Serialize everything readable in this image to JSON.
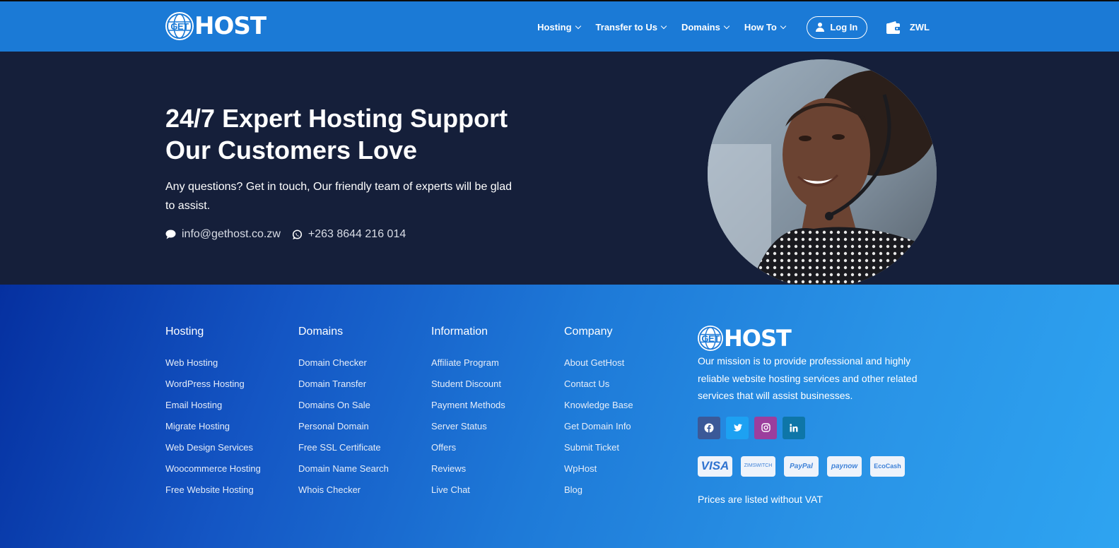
{
  "header": {
    "logo": {
      "prefix": "GET",
      "name": "HOST"
    },
    "nav": [
      {
        "label": "Hosting"
      },
      {
        "label": "Transfer to Us"
      },
      {
        "label": "Domains"
      },
      {
        "label": "How To"
      }
    ],
    "login_label": "Log In",
    "currency": "ZWL",
    "colors": {
      "header_bg": "#1b7ad6"
    }
  },
  "hero": {
    "title_line1": "24/7 Expert Hosting Support",
    "title_line2": "Our Customers Love",
    "subtitle": "Any questions? Get in touch, Our friendly team of experts will be glad to assist.",
    "email": "info@gethost.co.zw",
    "phone": "+263 8644 216 014",
    "email_icon": "chat-bubble-icon",
    "phone_icon": "whatsapp-icon",
    "colors": {
      "bg": "#151f3a"
    }
  },
  "footer": {
    "columns": [
      {
        "title": "Hosting",
        "links": [
          "Web Hosting",
          "WordPress Hosting",
          "Email Hosting",
          "Migrate Hosting",
          "Web Design Services",
          "Woocommerce Hosting",
          "Free Website Hosting"
        ]
      },
      {
        "title": "Domains",
        "links": [
          "Domain Checker",
          "Domain Transfer",
          "Domains On Sale",
          "Personal Domain",
          "Free SSL Certificate",
          "Domain Name Search",
          "Whois Checker"
        ]
      },
      {
        "title": "Information",
        "links": [
          "Affiliate Program",
          "Student Discount",
          "Payment Methods",
          "Server Status",
          "Offers",
          "Reviews",
          "Live Chat"
        ]
      },
      {
        "title": "Company",
        "links": [
          "About GetHost",
          "Contact Us",
          "Knowledge Base",
          "Get Domain Info",
          "Submit Ticket",
          "WpHost",
          "Blog"
        ]
      }
    ],
    "brand": {
      "logo": {
        "prefix": "GET",
        "name": "HOST"
      },
      "mission": "Our mission is to provide professional and highly reliable website hosting services and other related services that will assist businesses."
    },
    "socials": [
      {
        "icon": "facebook-icon",
        "color": "#3b5998"
      },
      {
        "icon": "twitter-icon",
        "color": "#1da1f2"
      },
      {
        "icon": "instagram-icon",
        "color": "#9c3e9d"
      },
      {
        "icon": "linkedin-icon",
        "color": "#0e76a8"
      }
    ],
    "payments": [
      {
        "label": "VISA"
      },
      {
        "label_top": "ZIM",
        "label_bottom": "SWITCH"
      },
      {
        "label": "PayPal"
      },
      {
        "label": "paynow"
      },
      {
        "label": "EcoCash"
      }
    ],
    "vat_note": "Prices are listed without VAT"
  }
}
